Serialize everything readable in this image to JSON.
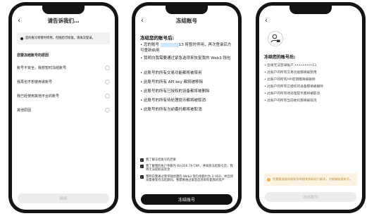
{
  "screen1": {
    "title": "请告诉我们…",
    "notice": "您的账号将暂时停用，但随后可恢复。请再次登录。",
    "section_title": "您要冻结账号的原因",
    "reasons": [
      "账号不安全，我想暂时冻结账号",
      "我再也不想使用该账号",
      "我已经使用其他平台的账号",
      "其他原因"
    ],
    "button": "继续"
  },
  "screen2": {
    "title": "冻结账号",
    "heading": "冻结您的账号后:",
    "bullets": [
      {
        "pre": "您的账号",
        "masked": "••••••••",
        "post": "13 将暂时停用，再次登录后方可重新启用"
      },
      {
        "pre": "我明白我需要通过紧急选项来恢复我的 Web3 钱包"
      },
      {
        "pre": "此账号的所有交易功能都将被禁用"
      },
      {
        "pre": "此账号的所有 API key 都将被移除"
      },
      {
        "pre": "此账号的所有已授权的设备都将被删除"
      },
      {
        "pre": "此账号的所有待处理提币都将被取消"
      },
      {
        "pre": "此账号的所有当前委托都将被取消"
      }
    ],
    "checks": [
      "我了解冻结账号的后果",
      "我了解我的账户余额为 60,056.79 CNY，并知悉冻结账号后，我将无法提取该资金",
      "我明白我通过我单独创建的 Web3 钱包余额约为 3 USD，并且将去需要等待冻结期间。我需要通过紧急选项来恢复我的资产"
    ],
    "button": "冻结账号"
  },
  "screen3": {
    "heading": "冻结您的账号后:",
    "bullets": [
      "您将无法登录账户 •••••••••13",
      "此账户的所有交易功能都将被禁用",
      "此账户的所有API密钥都将被删除",
      "此账户的所有已授权的设备都将被删除",
      "此账户的所有待处理提币都将被取消",
      "此账户的所有当前委托都将被取消"
    ],
    "warning": "您需要保留冻结账号的相关资料进行解冻，才能够恢复账号。",
    "button": "冻结账号"
  },
  "icons": {
    "back": "chevron-left-icon",
    "notice": "info-icon",
    "avatar": "user-lock-icon",
    "warning": "warning-icon"
  }
}
